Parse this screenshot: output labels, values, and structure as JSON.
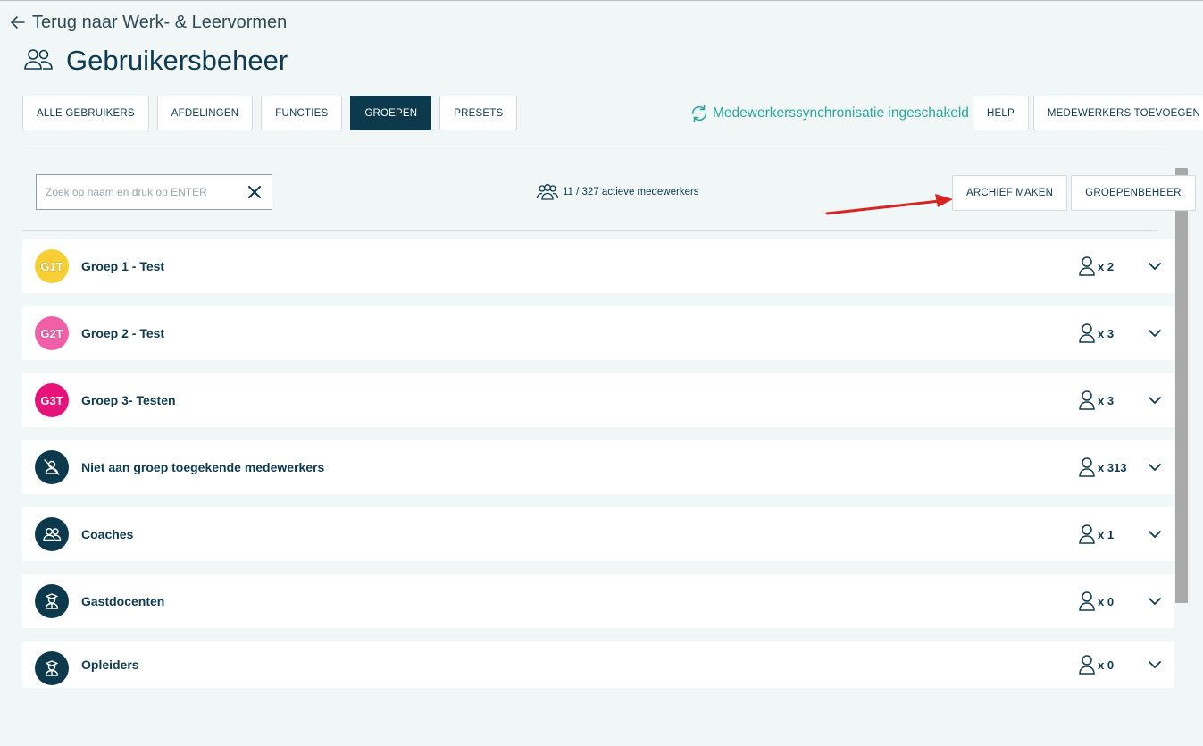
{
  "nav": {
    "back_label": "Terug naar Werk- & Leervormen"
  },
  "header": {
    "title": "Gebruikersbeheer",
    "icon": "users-icon"
  },
  "tabs": [
    {
      "label": "ALLE GEBRUIKERS",
      "active": false
    },
    {
      "label": "AFDELINGEN",
      "active": false
    },
    {
      "label": "FUNCTIES",
      "active": false
    },
    {
      "label": "GROEPEN",
      "active": true
    },
    {
      "label": "PRESETS",
      "active": false
    }
  ],
  "sync": {
    "label": "Medewerkerssynchronisatie ingeschakeld",
    "icon": "sync-icon",
    "color": "#2aa79b"
  },
  "header_actions": {
    "help_label": "HELP",
    "add_label": "MEDEWERKERS TOEVOEGEN"
  },
  "search": {
    "placeholder": "Zoek op naam en druk op ENTER",
    "value": ""
  },
  "active_count": {
    "label": "11 / 327 actieve medewerkers"
  },
  "list_actions": {
    "archive_label": "ARCHIEF MAKEN",
    "manage_label": "GROEPENBEHEER"
  },
  "annotation": {
    "arrow_color": "#d92323"
  },
  "groups": [
    {
      "avatar_text": "G1T",
      "avatar_color": "#f5cf33",
      "name": "Groep 1 - Test",
      "count": "x 2"
    },
    {
      "avatar_text": "G2T",
      "avatar_color": "#f25fa9",
      "name": "Groep 2 - Test",
      "count": "x 3"
    },
    {
      "avatar_text": "G3T",
      "avatar_color": "#e8137a",
      "name": "Groep 3- Testen",
      "count": "x 3"
    },
    {
      "avatar_icon": "user-slash-icon",
      "avatar_color": "#0c3a4c",
      "name": "Niet aan groep toegekende medewerkers",
      "count": "x 313"
    },
    {
      "avatar_icon": "users-icon",
      "avatar_color": "#0c3a4c",
      "name": "Coaches",
      "count": "x 1"
    },
    {
      "avatar_icon": "teacher-icon",
      "avatar_color": "#0c3a4c",
      "name": "Gastdocenten",
      "count": "x 0"
    },
    {
      "avatar_icon": "teacher-icon",
      "avatar_color": "#0c3a4c",
      "name": "Opleiders",
      "count": "x 0"
    }
  ]
}
